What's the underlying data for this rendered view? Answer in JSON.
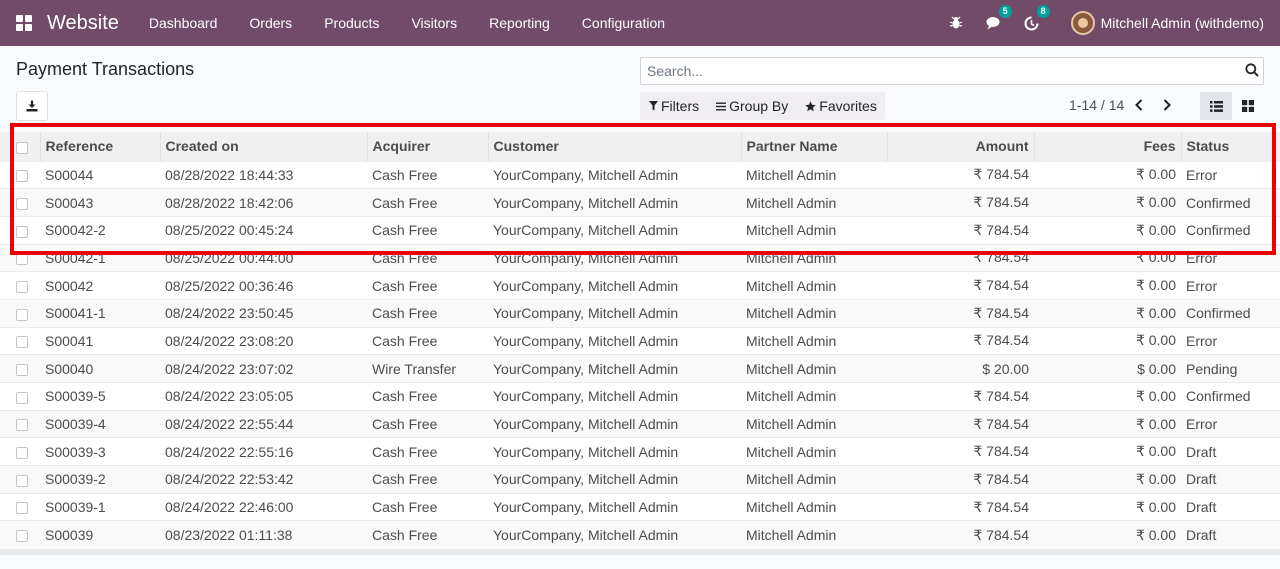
{
  "navbar": {
    "brand": "Website",
    "menu": [
      "Dashboard",
      "Orders",
      "Products",
      "Visitors",
      "Reporting",
      "Configuration"
    ],
    "messages_badge": "5",
    "activity_badge": "8",
    "user": "Mitchell Admin (withdemo)"
  },
  "control_panel": {
    "title": "Payment Transactions",
    "search_placeholder": "Search...",
    "filters_label": "Filters",
    "group_by_label": "Group By",
    "favorites_label": "Favorites",
    "pager": "1-14 / 14"
  },
  "table": {
    "headers": [
      "Reference",
      "Created on",
      "Acquirer",
      "Customer",
      "Partner Name",
      "Amount",
      "Fees",
      "Status"
    ],
    "rows": [
      [
        "S00044",
        "08/28/2022 18:44:33",
        "Cash Free",
        "YourCompany, Mitchell Admin",
        "Mitchell Admin",
        "₹ 784.54",
        "₹ 0.00",
        "Error"
      ],
      [
        "S00043",
        "08/28/2022 18:42:06",
        "Cash Free",
        "YourCompany, Mitchell Admin",
        "Mitchell Admin",
        "₹ 784.54",
        "₹ 0.00",
        "Confirmed"
      ],
      [
        "S00042-2",
        "08/25/2022 00:45:24",
        "Cash Free",
        "YourCompany, Mitchell Admin",
        "Mitchell Admin",
        "₹ 784.54",
        "₹ 0.00",
        "Confirmed"
      ],
      [
        "S00042-1",
        "08/25/2022 00:44:00",
        "Cash Free",
        "YourCompany, Mitchell Admin",
        "Mitchell Admin",
        "₹ 784.54",
        "₹ 0.00",
        "Error"
      ],
      [
        "S00042",
        "08/25/2022 00:36:46",
        "Cash Free",
        "YourCompany, Mitchell Admin",
        "Mitchell Admin",
        "₹ 784.54",
        "₹ 0.00",
        "Error"
      ],
      [
        "S00041-1",
        "08/24/2022 23:50:45",
        "Cash Free",
        "YourCompany, Mitchell Admin",
        "Mitchell Admin",
        "₹ 784.54",
        "₹ 0.00",
        "Confirmed"
      ],
      [
        "S00041",
        "08/24/2022 23:08:20",
        "Cash Free",
        "YourCompany, Mitchell Admin",
        "Mitchell Admin",
        "₹ 784.54",
        "₹ 0.00",
        "Error"
      ],
      [
        "S00040",
        "08/24/2022 23:07:02",
        "Wire Transfer",
        "YourCompany, Mitchell Admin",
        "Mitchell Admin",
        "$ 20.00",
        "$ 0.00",
        "Pending"
      ],
      [
        "S00039-5",
        "08/24/2022 23:05:05",
        "Cash Free",
        "YourCompany, Mitchell Admin",
        "Mitchell Admin",
        "₹ 784.54",
        "₹ 0.00",
        "Confirmed"
      ],
      [
        "S00039-4",
        "08/24/2022 22:55:44",
        "Cash Free",
        "YourCompany, Mitchell Admin",
        "Mitchell Admin",
        "₹ 784.54",
        "₹ 0.00",
        "Error"
      ],
      [
        "S00039-3",
        "08/24/2022 22:55:16",
        "Cash Free",
        "YourCompany, Mitchell Admin",
        "Mitchell Admin",
        "₹ 784.54",
        "₹ 0.00",
        "Draft"
      ],
      [
        "S00039-2",
        "08/24/2022 22:53:42",
        "Cash Free",
        "YourCompany, Mitchell Admin",
        "Mitchell Admin",
        "₹ 784.54",
        "₹ 0.00",
        "Draft"
      ],
      [
        "S00039-1",
        "08/24/2022 22:46:00",
        "Cash Free",
        "YourCompany, Mitchell Admin",
        "Mitchell Admin",
        "₹ 784.54",
        "₹ 0.00",
        "Draft"
      ],
      [
        "S00039",
        "08/23/2022 01:11:38",
        "Cash Free",
        "YourCompany, Mitchell Admin",
        "Mitchell Admin",
        "₹ 784.54",
        "₹ 0.00",
        "Draft"
      ]
    ]
  },
  "colors": {
    "navbar": "#714b67",
    "badge": "#00a09d",
    "highlight": "#ee0000"
  }
}
